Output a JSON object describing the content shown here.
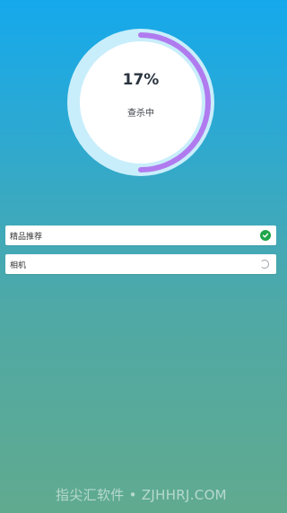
{
  "scan": {
    "percent_text": "17%",
    "progress": 0.17,
    "status_text": "查杀中"
  },
  "items": [
    {
      "label": "精品推荐",
      "state": "done",
      "icon": "check-circle-icon"
    },
    {
      "label": "相机",
      "state": "scanning",
      "icon": "spinner-icon"
    }
  ],
  "colors": {
    "ring_outer": "#C9EEFB",
    "ring_inner": "#FFFFFF",
    "progress_arc": "#B07BEF",
    "check": "#1FA64A"
  },
  "watermark": "指尖汇软件 • ZJHHRJ.COM"
}
